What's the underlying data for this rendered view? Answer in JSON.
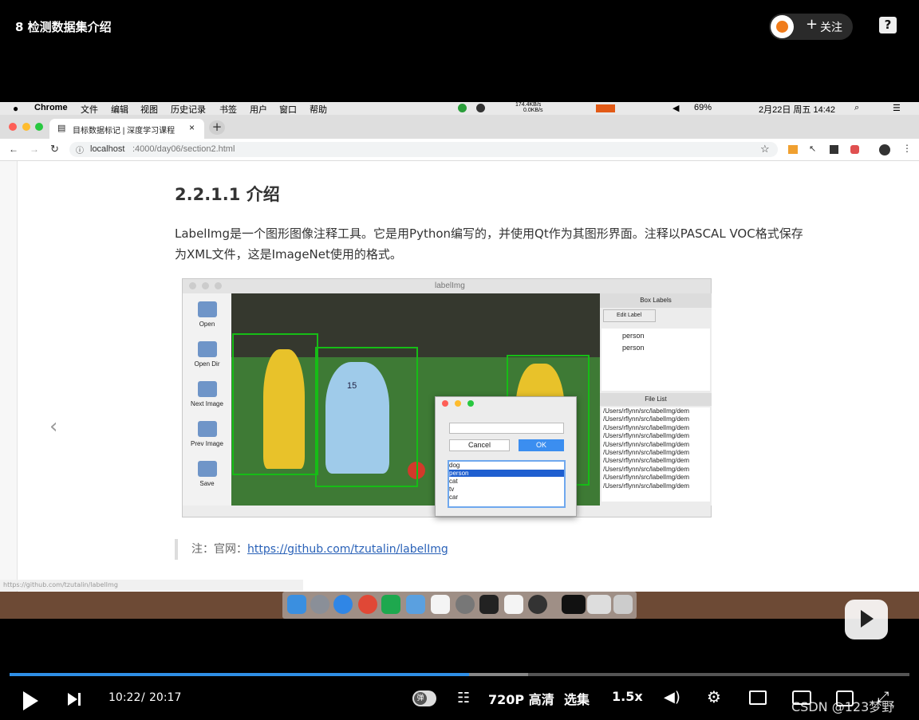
{
  "player": {
    "title": "8 检测数据集介绍",
    "follow_label": "关注",
    "follow_plus": "+",
    "help": "?",
    "time_current": "10:22",
    "time_sep": "/",
    "time_total": "20:17",
    "danmaku_label": "弹",
    "quality": "720P 高清",
    "episodes": "选集",
    "speed": "1.5x",
    "progress_fraction": 0.511,
    "watermark": "CSDN @123梦野"
  },
  "mac_menu": {
    "app": "Chrome",
    "items": [
      "文件",
      "编辑",
      "视图",
      "历史记录",
      "书签",
      "用户",
      "窗口",
      "帮助"
    ],
    "net_up": "174.4KB/s",
    "net_down": "0.0KB/s",
    "battery": "69%",
    "clock": "2月22日 周五 14:42"
  },
  "browser": {
    "tab_title": "目标数据标记 | 深度学习课程",
    "tab_close": "×",
    "new_tab": "+",
    "url_host": "localhost",
    "url_path": ":4000/day06/section2.html"
  },
  "article": {
    "heading": "2.2.1.1 介绍",
    "paragraph": "LabelImg是一个图形图像注释工具。它是用Python编写的，并使用Qt作为其图形界面。注释以PASCAL VOC格式保存为XML文件，这是ImageNet使用的格式。",
    "note_label": "注：官网：",
    "note_link": "https://github.com/tzutalin/labelImg",
    "status_url": "https://github.com/tzutalin/labelImg",
    "prev_arrow": "‹"
  },
  "labelimg": {
    "window_title": "labelImg",
    "tools": [
      "Open",
      "Open Dir",
      "Next Image",
      "Prev Image",
      "Save"
    ],
    "box_labels_title": "Box Labels",
    "edit_label": "Edit Label",
    "labels": [
      "person",
      "person"
    ],
    "file_list_title": "File List",
    "files": [
      "/Users/rflynn/src/labelImg/dem",
      "/Users/rflynn/src/labelImg/dem",
      "/Users/rflynn/src/labelImg/dem",
      "/Users/rflynn/src/labelImg/dem",
      "/Users/rflynn/src/labelImg/dem",
      "/Users/rflynn/src/labelImg/dem",
      "/Users/rflynn/src/labelImg/dem",
      "/Users/rflynn/src/labelImg/dem",
      "/Users/rflynn/src/labelImg/dem",
      "/Users/rflynn/src/labelImg/dem"
    ],
    "dialog": {
      "cancel": "Cancel",
      "ok": "OK",
      "options": [
        "dog",
        "person",
        "cat",
        "tv",
        "car"
      ],
      "selected": "person"
    },
    "jersey_number": "15"
  },
  "colors": {
    "accent": "#2f8fe6",
    "link": "#2a62b8",
    "bbox": "#16bd16"
  }
}
